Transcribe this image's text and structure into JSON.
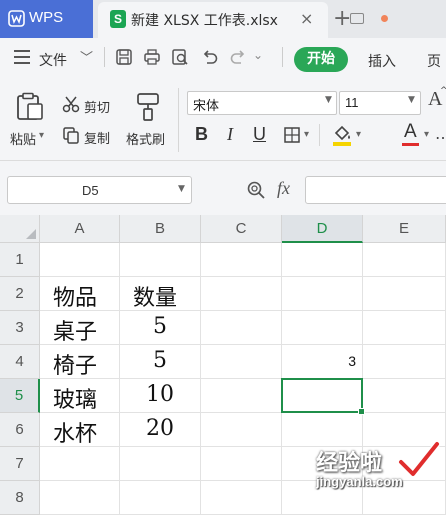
{
  "app": {
    "name": "WPS"
  },
  "document_tab": {
    "title": "新建 XLSX 工作表.xlsx",
    "close": "×",
    "new_tab": "+"
  },
  "menu": {
    "file": "文件",
    "start": "开始",
    "insert": "插入",
    "page": "页"
  },
  "ribbon": {
    "paste": "粘贴",
    "cut": "剪切",
    "copy": "复制",
    "format_painter": "格式刷",
    "font_name": "宋体",
    "font_size": "11",
    "bold": "B",
    "italic": "I",
    "underline": "U",
    "font_color_glyph": "A",
    "grow_font_glyph": "A"
  },
  "formula_bar": {
    "name_box": "D5",
    "fx": "fx",
    "value": ""
  },
  "sheet": {
    "columns": [
      "A",
      "B",
      "C",
      "D",
      "E"
    ],
    "selected_column": "D",
    "rows": [
      "1",
      "2",
      "3",
      "4",
      "5",
      "6",
      "7",
      "8"
    ],
    "selected_row": "5",
    "cells": {
      "A2": "物品",
      "B2": "数量",
      "A3": "桌子",
      "B3": "5",
      "A4": "椅子",
      "B4": "5",
      "D4": "3",
      "A5": "玻璃",
      "B5": "10",
      "A6": "水杯",
      "B6": "20"
    },
    "selected_cell": "D5"
  },
  "watermark": {
    "text": "经验啦",
    "url": "jingyanla.com"
  },
  "colors": {
    "wps_blue": "#4a6fd6",
    "accent_green": "#2aa757",
    "selection_green": "#1f8f4a",
    "font_color_red": "#e02d2d",
    "highlight_yellow": "#f5d400"
  }
}
